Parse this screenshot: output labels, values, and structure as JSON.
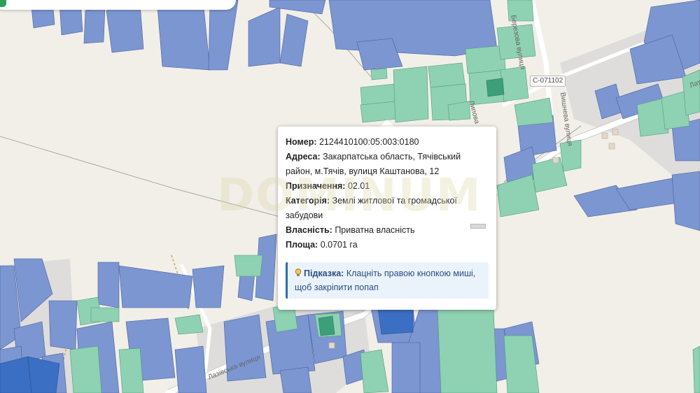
{
  "popup": {
    "number_label": "Номер:",
    "number_value": "2124410100:05:003:0180",
    "address_label": "Адреса:",
    "address_value_1": "Закарпатська область, Тячівський",
    "address_value_2": "район, м.Тячів, вулиця Каштанова, 12",
    "purpose_label": "Призначення:",
    "purpose_value": "02.01",
    "category_label": "Категорія:",
    "category_value_1": "Землі житлової та громадської",
    "category_value_2": "забудови",
    "ownership_label": "Власність:",
    "ownership_value": "Приватна власність",
    "area_label": "Площа:",
    "area_value": "0.0701 га",
    "hint_label": "Підказка:",
    "hint_text_1": "Клацніть правою кнопкою миші,",
    "hint_text_2": "щоб закріпити попап"
  },
  "watermark": "DOMINUM",
  "map_labels": {
    "road_badge": "С-071102",
    "street_laz": "Лазівська вулиця",
    "street_vyshneva": "Вишнева вулиця",
    "street_beresova": "Березова вулиця",
    "street_lypova": "Липова",
    "street_lat": "Лат"
  },
  "colors": {
    "parcel_blue": "#7b96d1",
    "parcel_green": "#8fd1b3",
    "parcel_dark": "#3b6fc4",
    "land_gray": "#d9d9d9",
    "road_white": "#ffffff"
  }
}
